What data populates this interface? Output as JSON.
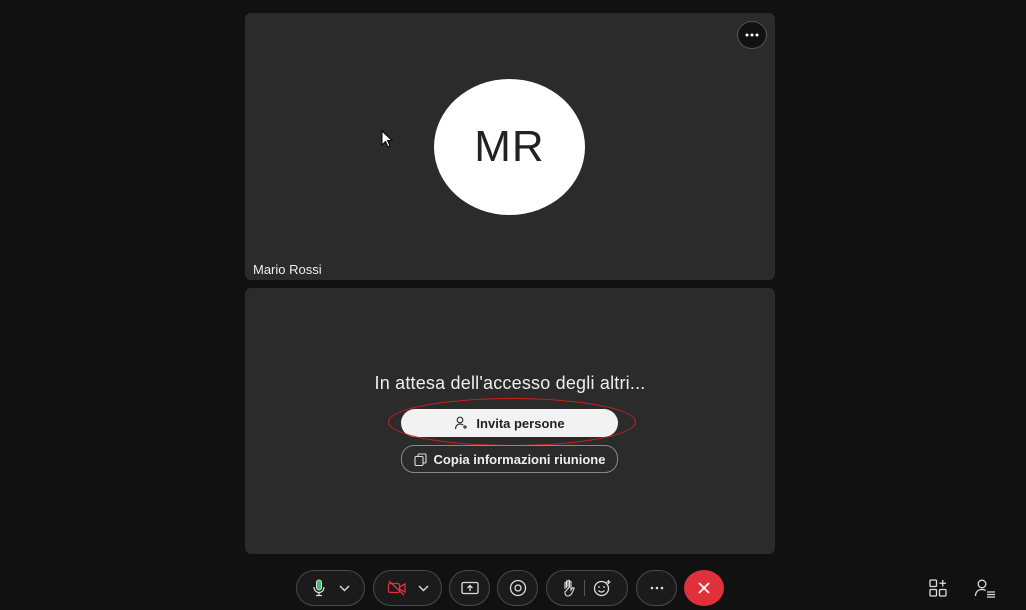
{
  "participant": {
    "initials": "MR",
    "name": "Mario Rossi"
  },
  "waiting_panel": {
    "message": "In attesa dell'accesso degli altri...",
    "invite_label": "Invita persone",
    "copy_label": "Copia informazioni riunione"
  },
  "icons": {
    "tile_menu": "more-horizontal-icon",
    "mic": "microphone-icon",
    "camera": "camera-off-icon",
    "share": "share-screen-icon",
    "view": "eye-icon",
    "hand": "raise-hand-icon",
    "reaction": "emoji-plus-icon",
    "more": "more-horizontal-icon",
    "end": "close-icon",
    "apps": "apps-add-icon",
    "participants": "participants-icon"
  },
  "colors": {
    "background": "#111111",
    "tile": "#2b2b2b",
    "end_call": "#e0303a",
    "highlight": "#d42020",
    "camera_off": "#e0303a"
  }
}
